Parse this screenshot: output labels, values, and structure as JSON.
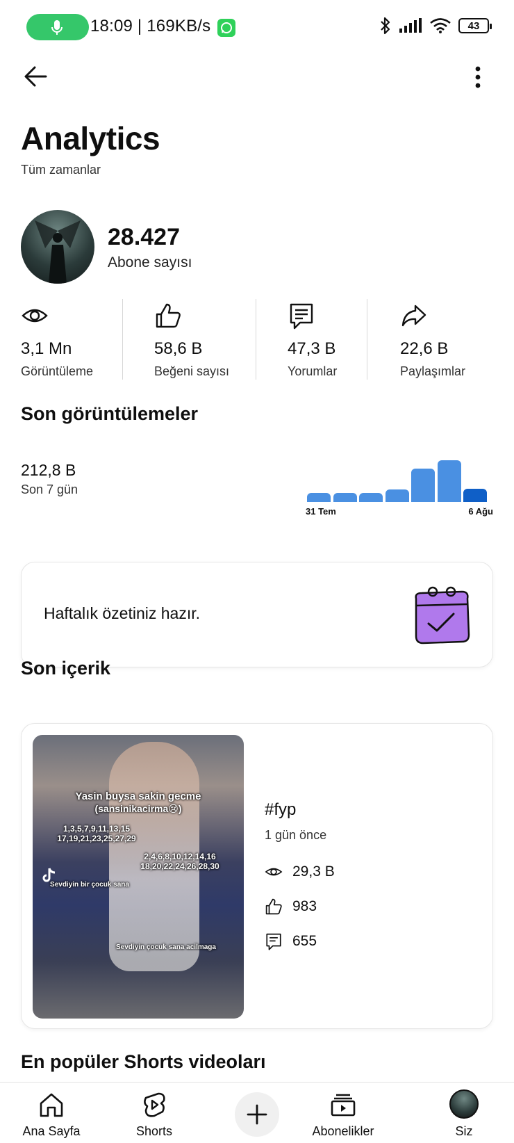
{
  "status_bar": {
    "text": "18:09 | 169KB/s",
    "battery": "43"
  },
  "header": {
    "title": "Analytics",
    "subtitle": "Tüm zamanlar"
  },
  "channel": {
    "subscriber_count": "28.427",
    "subscriber_label": "Abone sayısı"
  },
  "stats": [
    {
      "icon": "eye-icon",
      "value": "3,1 Mn",
      "label": "Görüntüleme"
    },
    {
      "icon": "thumbs-up-icon",
      "value": "58,6 B",
      "label": "Beğeni sayısı"
    },
    {
      "icon": "comment-icon",
      "value": "47,3 B",
      "label": "Yorumlar"
    },
    {
      "icon": "share-icon",
      "value": "22,6 B",
      "label": "Paylaşımlar"
    }
  ],
  "recent_views": {
    "heading": "Son görüntülemeler",
    "value": "212,8 B",
    "period": "Son 7 gün"
  },
  "chart_data": {
    "type": "bar",
    "categories": [
      "31 Tem",
      "1",
      "2",
      "3",
      "4",
      "5",
      "6 Ağu"
    ],
    "tick_labels": [
      "31 Tem",
      "6 Ağu"
    ],
    "values": [
      0.22,
      0.22,
      0.22,
      0.3,
      0.8,
      1.0,
      0.32
    ],
    "value_scale": "relative",
    "bar_color": "#4a90e2",
    "last_bar_color": "#0f5fc7"
  },
  "weekly_summary": {
    "text": "Haftalık özetiniz hazır."
  },
  "recent_content": {
    "heading": "Son içerik",
    "thumbnail_text": [
      "Yasin buysa sakin gecme",
      "(sansinikacirma😢)",
      "1,3,5,7,9,11,13,15",
      "17,19,21,23,25,27,29",
      "2,4,6,8,10,12,14,16",
      "18,20,22,24,26,28,30",
      "Sevdiyin bir çocuk sana",
      "Sevdiyin çocuk sana acilmaga"
    ],
    "title": "#fyp",
    "time": "1 gün önce",
    "views": "29,3 B",
    "likes": "983",
    "comments": "655"
  },
  "popular_shorts": {
    "heading": "En popüler Shorts videoları"
  },
  "bottom_nav": [
    {
      "label": "Ana Sayfa",
      "icon": "home-icon"
    },
    {
      "label": "Shorts",
      "icon": "shorts-icon"
    },
    {
      "label": "",
      "icon": "plus-icon"
    },
    {
      "label": "Abonelikler",
      "icon": "subscriptions-icon"
    },
    {
      "label": "Siz",
      "icon": "avatar"
    }
  ]
}
